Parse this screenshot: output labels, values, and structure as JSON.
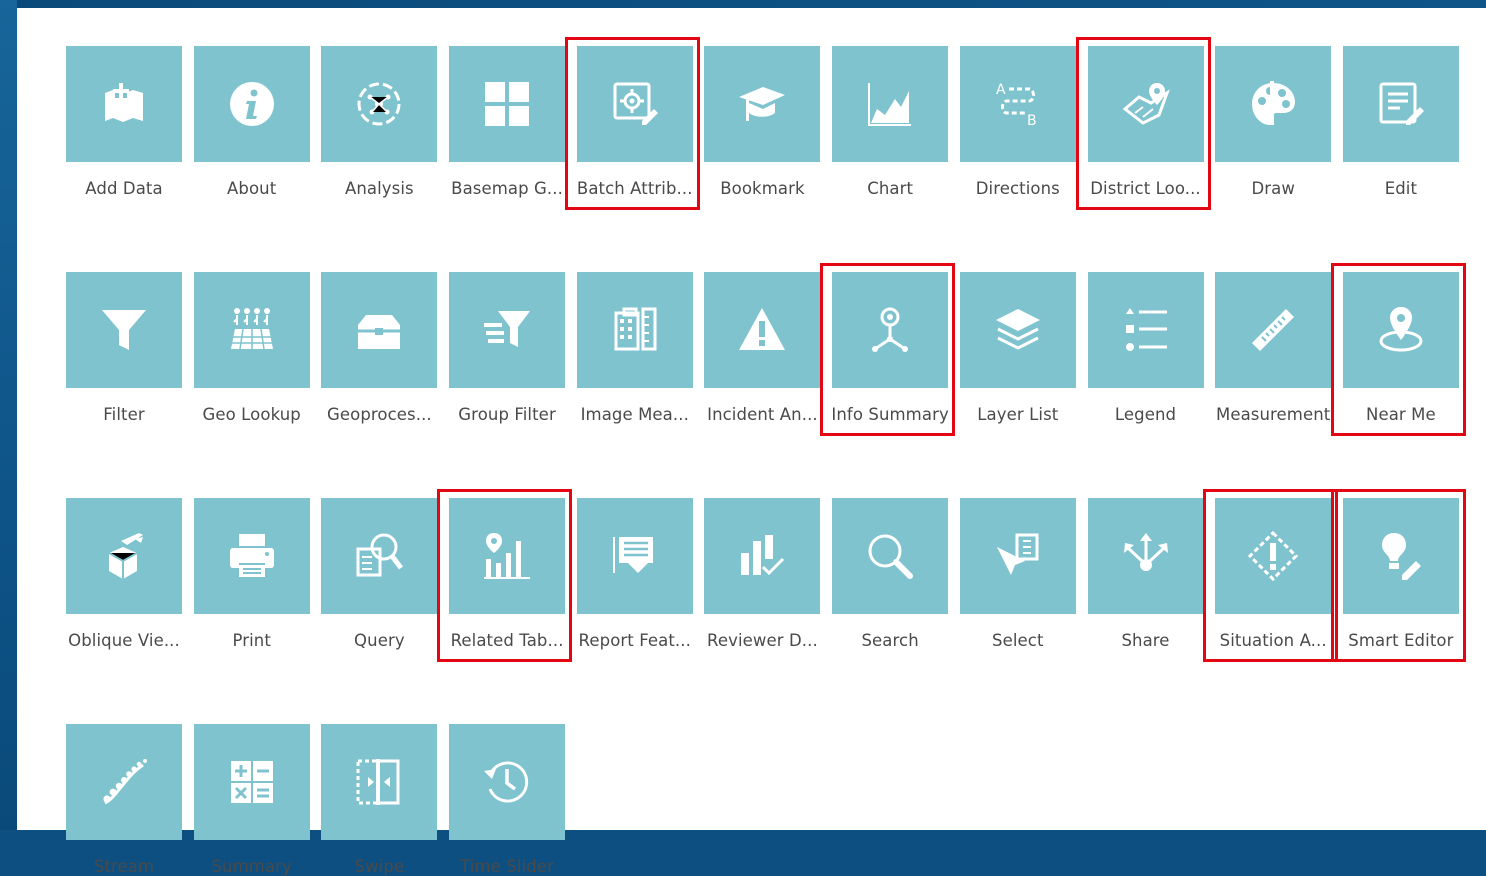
{
  "widgets": [
    {
      "label": "Add Data",
      "icon": "add-data-icon",
      "highlighted": false
    },
    {
      "label": "About",
      "icon": "info-icon",
      "highlighted": false
    },
    {
      "label": "Analysis",
      "icon": "analysis-icon",
      "highlighted": false
    },
    {
      "label": "Basemap G...",
      "icon": "basemap-gallery-icon",
      "highlighted": false
    },
    {
      "label": "Batch Attrib...",
      "icon": "batch-attribute-icon",
      "highlighted": true
    },
    {
      "label": "Bookmark",
      "icon": "bookmark-icon",
      "highlighted": false
    },
    {
      "label": "Chart",
      "icon": "chart-icon",
      "highlighted": false
    },
    {
      "label": "Directions",
      "icon": "directions-icon",
      "highlighted": false
    },
    {
      "label": "District Loo...",
      "icon": "district-lookup-icon",
      "highlighted": true
    },
    {
      "label": "Draw",
      "icon": "draw-palette-icon",
      "highlighted": false
    },
    {
      "label": "Edit",
      "icon": "edit-icon",
      "highlighted": false
    },
    {
      "label": "Filter",
      "icon": "filter-icon",
      "highlighted": false
    },
    {
      "label": "Geo Lookup",
      "icon": "geo-lookup-icon",
      "highlighted": false
    },
    {
      "label": "Geoproces...",
      "icon": "geoprocessing-toolbox-icon",
      "highlighted": false
    },
    {
      "label": "Group Filter",
      "icon": "group-filter-icon",
      "highlighted": false
    },
    {
      "label": "Image Mea...",
      "icon": "image-measurement-icon",
      "highlighted": false
    },
    {
      "label": "Incident An...",
      "icon": "incident-analysis-icon",
      "highlighted": false
    },
    {
      "label": "Info Summary",
      "icon": "info-summary-icon",
      "highlighted": true
    },
    {
      "label": "Layer List",
      "icon": "layer-list-icon",
      "highlighted": false
    },
    {
      "label": "Legend",
      "icon": "legend-icon",
      "highlighted": false
    },
    {
      "label": "Measurement",
      "icon": "ruler-icon",
      "highlighted": false
    },
    {
      "label": "Near Me",
      "icon": "near-me-icon",
      "highlighted": true
    },
    {
      "label": "Oblique Vie...",
      "icon": "oblique-viewer-icon",
      "highlighted": false
    },
    {
      "label": "Print",
      "icon": "printer-icon",
      "highlighted": false
    },
    {
      "label": "Query",
      "icon": "query-icon",
      "highlighted": false
    },
    {
      "label": "Related Tab...",
      "icon": "related-table-icon",
      "highlighted": true
    },
    {
      "label": "Report Feat...",
      "icon": "report-feature-icon",
      "highlighted": false
    },
    {
      "label": "Reviewer D...",
      "icon": "reviewer-dashboard-icon",
      "highlighted": false
    },
    {
      "label": "Search",
      "icon": "search-icon",
      "highlighted": false
    },
    {
      "label": "Select",
      "icon": "select-icon",
      "highlighted": false
    },
    {
      "label": "Share",
      "icon": "share-icon",
      "highlighted": false
    },
    {
      "label": "Situation A...",
      "icon": "situation-awareness-icon",
      "highlighted": true
    },
    {
      "label": "Smart Editor",
      "icon": "smart-editor-icon",
      "highlighted": true
    },
    {
      "label": "Stream",
      "icon": "stream-icon",
      "highlighted": false
    },
    {
      "label": "Summary",
      "icon": "calculator-icon",
      "highlighted": false
    },
    {
      "label": "Swipe",
      "icon": "swipe-icon",
      "highlighted": false
    },
    {
      "label": "Time Slider",
      "icon": "clock-icon",
      "highlighted": false
    }
  ],
  "colors": {
    "tile": "#7fc3cf",
    "icon": "#ffffff",
    "highlight": "#e30613",
    "label": "#4a4a4a",
    "frame": "#0d4f80"
  }
}
